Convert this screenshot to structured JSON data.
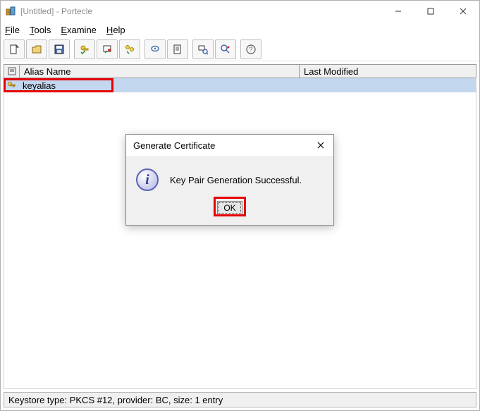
{
  "title": "[Untitled] - Portecle",
  "menu": {
    "file": {
      "label": "File",
      "u": "F"
    },
    "tools": {
      "label": "Tools",
      "u": "T"
    },
    "examine": {
      "label": "Examine",
      "u": "E"
    },
    "help": {
      "label": "Help",
      "u": "H"
    }
  },
  "toolbar": {
    "new": "New Keystore",
    "open": "Open Keystore",
    "save": "Save Keystore",
    "genkey": "Generate Key Pair",
    "importcert": "Import Trusted Certificate",
    "importkey": "Import Key Pair",
    "setpass": "Set Keystore Password",
    "report": "Keystore Report",
    "examcert": "Examine Certificate",
    "examssl": "Examine SSL",
    "help": "Help"
  },
  "table": {
    "headers": {
      "icon": "",
      "alias": "Alias Name",
      "modified": "Last Modified"
    },
    "rows": [
      {
        "alias": "keyalias",
        "modified": ""
      }
    ]
  },
  "dialog": {
    "title": "Generate Certificate",
    "message": "Key Pair Generation Successful.",
    "ok": "OK"
  },
  "status": "Keystore type: PKCS #12, provider: BC, size: 1 entry"
}
